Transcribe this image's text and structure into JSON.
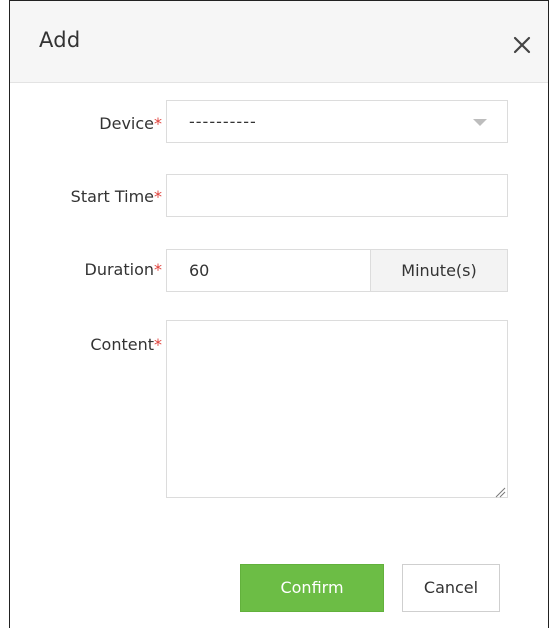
{
  "dialog": {
    "title": "Add",
    "close_icon": "close-icon"
  },
  "form": {
    "required_mark": "*",
    "device": {
      "label": "Device",
      "selected": "----------"
    },
    "start_time": {
      "label": "Start Time",
      "value": ""
    },
    "duration": {
      "label": "Duration",
      "value": "60",
      "unit": "Minute(s)"
    },
    "content": {
      "label": "Content",
      "value": ""
    }
  },
  "actions": {
    "confirm_label": "Confirm",
    "cancel_label": "Cancel"
  },
  "colors": {
    "confirm_bg": "#6cbd45",
    "required_mark": "#e0403a",
    "header_bg": "#f6f6f6"
  }
}
